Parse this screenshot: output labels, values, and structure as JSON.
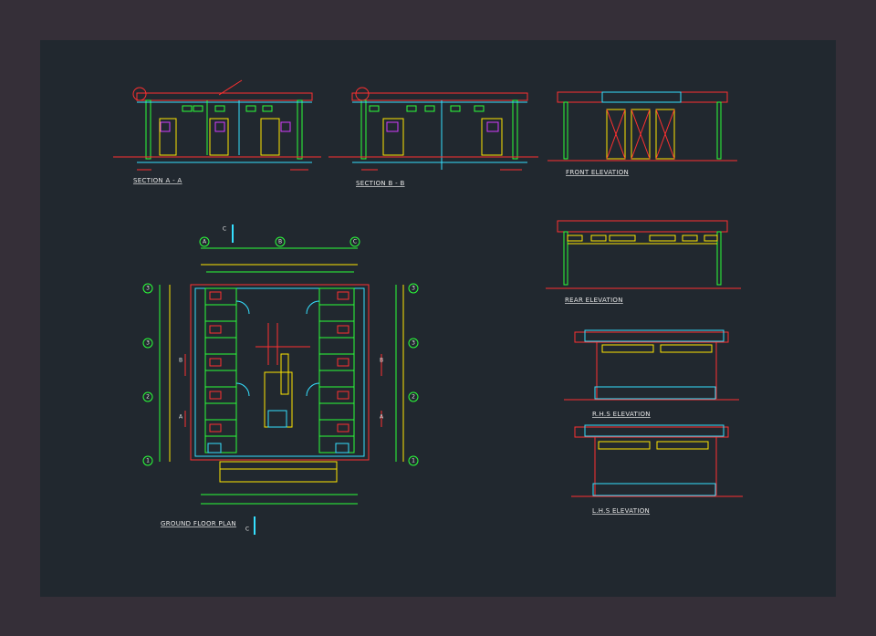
{
  "colors": {
    "background": "#352f38",
    "sheet": "#21282f",
    "wall": "#ff3030",
    "cyan": "#35e0ff",
    "green": "#2bff3a",
    "yellow": "#ffe600",
    "magenta": "#d43cff",
    "label": "#e6e6e6"
  },
  "labels": {
    "section_a": "SECTION A - A",
    "section_b": "SECTION B - B",
    "front_elevation": "FRONT ELEVATION",
    "rear_elevation": "REAR ELEVATION",
    "rhs_elevation": "R.H.S ELEVATION",
    "lhs_elevation": "L.H.S ELEVATION",
    "ground_floor_plan": "GROUND FLOOR PLAN"
  },
  "plan": {
    "grid_top": [
      "A",
      "B",
      "C"
    ],
    "grid_side": [
      "3",
      "3",
      "2",
      "1"
    ],
    "section_marks": [
      "C",
      "B",
      "A",
      "B",
      "A",
      "C"
    ]
  }
}
